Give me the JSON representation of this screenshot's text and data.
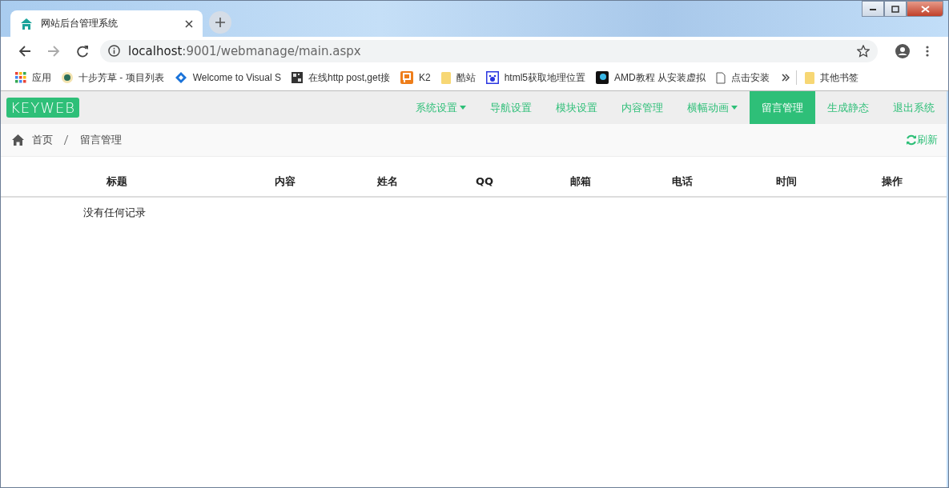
{
  "browser": {
    "tab_title": "网站后台管理系统",
    "url_host": "localhost",
    "url_path": ":9001/webmanage/main.aspx",
    "bookmarks": [
      {
        "label": "应用",
        "kind": "apps"
      },
      {
        "label": "十步芳草 - 项目列表",
        "kind": "round"
      },
      {
        "label": "Welcome to Visual S",
        "kind": "vs"
      },
      {
        "label": "在线http post,get接",
        "kind": "qr"
      },
      {
        "label": "K2",
        "kind": "p"
      },
      {
        "label": "酷站",
        "kind": "folder"
      },
      {
        "label": "html5获取地理位置",
        "kind": "paw"
      },
      {
        "label": "AMD教程 从安装虚拟",
        "kind": "dark"
      },
      {
        "label": "点击安装",
        "kind": "page"
      }
    ],
    "other_bookmarks": "其他书签"
  },
  "logo": "KEYWEB",
  "nav": [
    {
      "label": "系统设置",
      "dropdown": true,
      "selected": false
    },
    {
      "label": "导航设置",
      "dropdown": false,
      "selected": false
    },
    {
      "label": "模块设置",
      "dropdown": false,
      "selected": false
    },
    {
      "label": "内容管理",
      "dropdown": false,
      "selected": false
    },
    {
      "label": "横幅动画",
      "dropdown": true,
      "selected": false
    },
    {
      "label": "留言管理",
      "dropdown": false,
      "selected": true
    },
    {
      "label": "生成静态",
      "dropdown": false,
      "selected": false
    },
    {
      "label": "退出系统",
      "dropdown": false,
      "selected": false
    }
  ],
  "breadcrumb": [
    "首页",
    "留言管理"
  ],
  "refresh": "刷新",
  "table": {
    "columns": [
      "标题",
      "内容",
      "姓名",
      "QQ",
      "邮箱",
      "电话",
      "时间",
      "操作"
    ],
    "empty_text": "没有任何记录"
  }
}
